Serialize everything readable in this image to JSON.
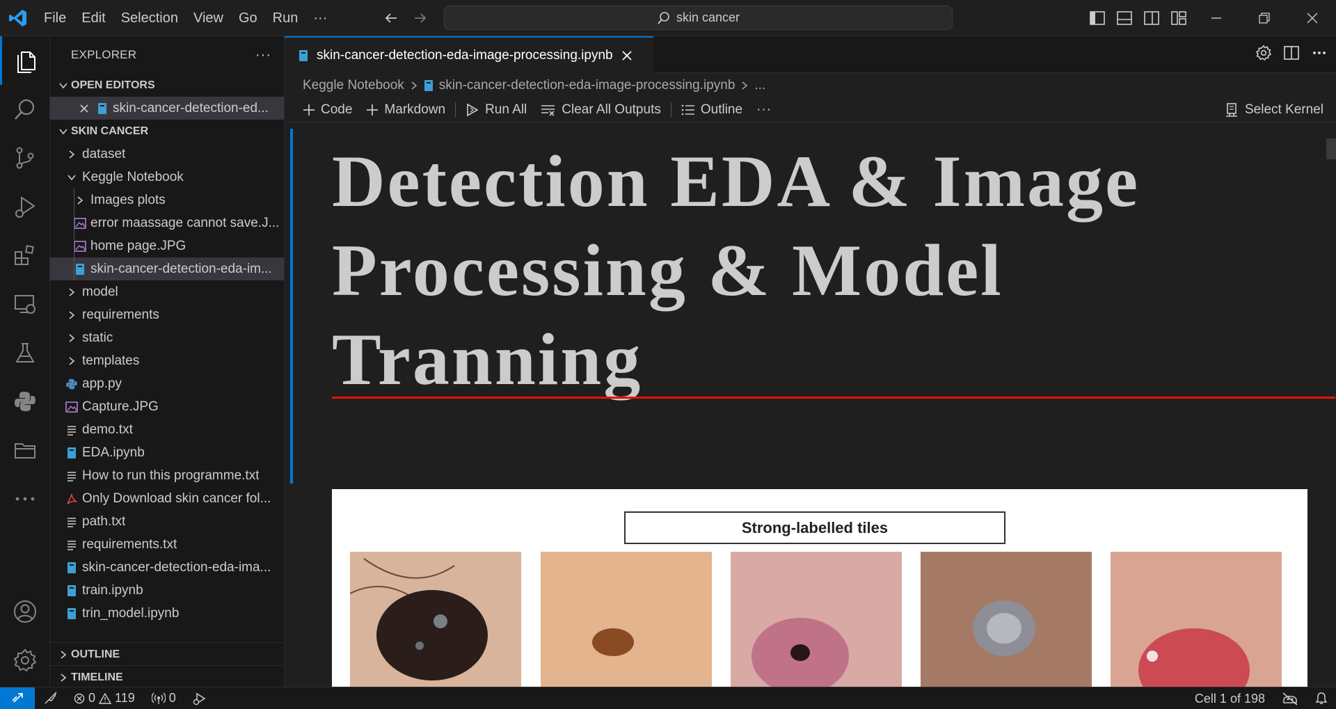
{
  "menu": [
    "File",
    "Edit",
    "Selection",
    "View",
    "Go",
    "Run",
    "···"
  ],
  "search": {
    "text": "skin cancer"
  },
  "explorer": {
    "title": "EXPLORER",
    "more": "···",
    "open_editors_label": "OPEN EDITORS",
    "open_editor_file": "skin-cancer-detection-ed...",
    "workspace_label": "SKIN CANCER",
    "items": [
      {
        "label": "dataset",
        "type": "folder",
        "depth": 1,
        "expanded": false
      },
      {
        "label": "Keggle Notebook",
        "type": "folder",
        "depth": 1,
        "expanded": true
      },
      {
        "label": "Images plots",
        "type": "folder",
        "depth": 2,
        "expanded": false
      },
      {
        "label": "error maassage cannot save.J...",
        "type": "image",
        "depth": 2
      },
      {
        "label": "home page.JPG",
        "type": "image",
        "depth": 2
      },
      {
        "label": "skin-cancer-detection-eda-im...",
        "type": "notebook",
        "depth": 2,
        "selected": true
      },
      {
        "label": "model",
        "type": "folder",
        "depth": 1,
        "expanded": false
      },
      {
        "label": "requirements",
        "type": "folder",
        "depth": 1,
        "expanded": false
      },
      {
        "label": "static",
        "type": "folder",
        "depth": 1,
        "expanded": false
      },
      {
        "label": "templates",
        "type": "folder",
        "depth": 1,
        "expanded": false
      },
      {
        "label": "app.py",
        "type": "python",
        "depth": 1
      },
      {
        "label": "Capture.JPG",
        "type": "image",
        "depth": 1
      },
      {
        "label": "demo.txt",
        "type": "text",
        "depth": 1
      },
      {
        "label": "EDA.ipynb",
        "type": "notebook",
        "depth": 1
      },
      {
        "label": "How to run this programme.txt",
        "type": "text",
        "depth": 1
      },
      {
        "label": "Only Download skin cancer fol...",
        "type": "pdf",
        "depth": 1
      },
      {
        "label": "path.txt",
        "type": "text",
        "depth": 1
      },
      {
        "label": "requirements.txt",
        "type": "text",
        "depth": 1
      },
      {
        "label": "skin-cancer-detection-eda-ima...",
        "type": "notebook",
        "depth": 1
      },
      {
        "label": "train.ipynb",
        "type": "notebook",
        "depth": 1
      },
      {
        "label": "trin_model.ipynb",
        "type": "notebook",
        "depth": 1
      }
    ],
    "outline_label": "OUTLINE",
    "timeline_label": "TIMELINE"
  },
  "tab": {
    "label": "skin-cancer-detection-eda-image-processing.ipynb"
  },
  "breadcrumb": {
    "folder": "Keggle Notebook",
    "file": "skin-cancer-detection-eda-image-processing.ipynb",
    "more": "..."
  },
  "toolbar": {
    "code": "Code",
    "markdown": "Markdown",
    "run_all": "Run All",
    "clear_outputs": "Clear All Outputs",
    "outline": "Outline",
    "more": "···",
    "select_kernel": "Select Kernel"
  },
  "notebook": {
    "heading_line1": "Detection EDA & Image",
    "heading_line2": "Processing & Model",
    "heading_line3": "Tranning",
    "panel_title": "Strong-labelled tiles"
  },
  "statusbar": {
    "errors": "0",
    "warnings": "119",
    "ports": "0",
    "cell_info": "Cell 1 of 198"
  },
  "colors": {
    "accent": "#0078d4",
    "rule": "#e51400",
    "background": "#1f1f1f",
    "sidebar": "#181818"
  }
}
